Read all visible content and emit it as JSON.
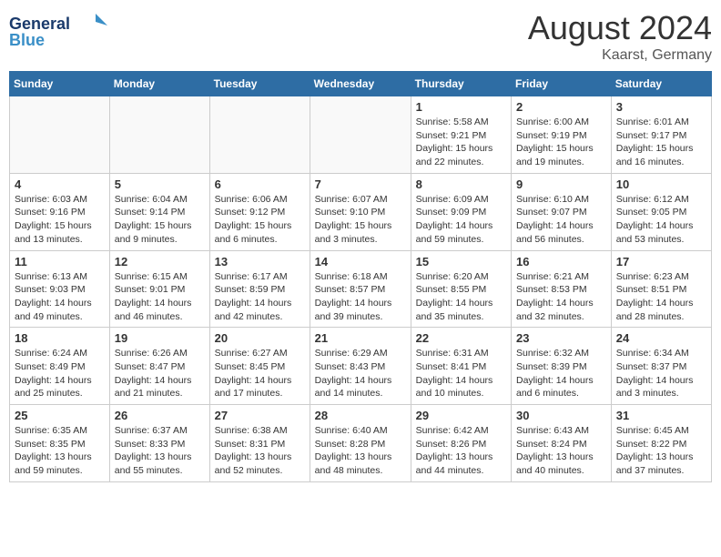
{
  "header": {
    "logo_general": "General",
    "logo_blue": "Blue",
    "month": "August 2024",
    "location": "Kaarst, Germany"
  },
  "weekdays": [
    "Sunday",
    "Monday",
    "Tuesday",
    "Wednesday",
    "Thursday",
    "Friday",
    "Saturday"
  ],
  "weeks": [
    [
      {
        "date": "",
        "info": ""
      },
      {
        "date": "",
        "info": ""
      },
      {
        "date": "",
        "info": ""
      },
      {
        "date": "",
        "info": ""
      },
      {
        "date": "1",
        "info": "Sunrise: 5:58 AM\nSunset: 9:21 PM\nDaylight: 15 hours and 22 minutes."
      },
      {
        "date": "2",
        "info": "Sunrise: 6:00 AM\nSunset: 9:19 PM\nDaylight: 15 hours and 19 minutes."
      },
      {
        "date": "3",
        "info": "Sunrise: 6:01 AM\nSunset: 9:17 PM\nDaylight: 15 hours and 16 minutes."
      }
    ],
    [
      {
        "date": "4",
        "info": "Sunrise: 6:03 AM\nSunset: 9:16 PM\nDaylight: 15 hours and 13 minutes."
      },
      {
        "date": "5",
        "info": "Sunrise: 6:04 AM\nSunset: 9:14 PM\nDaylight: 15 hours and 9 minutes."
      },
      {
        "date": "6",
        "info": "Sunrise: 6:06 AM\nSunset: 9:12 PM\nDaylight: 15 hours and 6 minutes."
      },
      {
        "date": "7",
        "info": "Sunrise: 6:07 AM\nSunset: 9:10 PM\nDaylight: 15 hours and 3 minutes."
      },
      {
        "date": "8",
        "info": "Sunrise: 6:09 AM\nSunset: 9:09 PM\nDaylight: 14 hours and 59 minutes."
      },
      {
        "date": "9",
        "info": "Sunrise: 6:10 AM\nSunset: 9:07 PM\nDaylight: 14 hours and 56 minutes."
      },
      {
        "date": "10",
        "info": "Sunrise: 6:12 AM\nSunset: 9:05 PM\nDaylight: 14 hours and 53 minutes."
      }
    ],
    [
      {
        "date": "11",
        "info": "Sunrise: 6:13 AM\nSunset: 9:03 PM\nDaylight: 14 hours and 49 minutes."
      },
      {
        "date": "12",
        "info": "Sunrise: 6:15 AM\nSunset: 9:01 PM\nDaylight: 14 hours and 46 minutes."
      },
      {
        "date": "13",
        "info": "Sunrise: 6:17 AM\nSunset: 8:59 PM\nDaylight: 14 hours and 42 minutes."
      },
      {
        "date": "14",
        "info": "Sunrise: 6:18 AM\nSunset: 8:57 PM\nDaylight: 14 hours and 39 minutes."
      },
      {
        "date": "15",
        "info": "Sunrise: 6:20 AM\nSunset: 8:55 PM\nDaylight: 14 hours and 35 minutes."
      },
      {
        "date": "16",
        "info": "Sunrise: 6:21 AM\nSunset: 8:53 PM\nDaylight: 14 hours and 32 minutes."
      },
      {
        "date": "17",
        "info": "Sunrise: 6:23 AM\nSunset: 8:51 PM\nDaylight: 14 hours and 28 minutes."
      }
    ],
    [
      {
        "date": "18",
        "info": "Sunrise: 6:24 AM\nSunset: 8:49 PM\nDaylight: 14 hours and 25 minutes."
      },
      {
        "date": "19",
        "info": "Sunrise: 6:26 AM\nSunset: 8:47 PM\nDaylight: 14 hours and 21 minutes."
      },
      {
        "date": "20",
        "info": "Sunrise: 6:27 AM\nSunset: 8:45 PM\nDaylight: 14 hours and 17 minutes."
      },
      {
        "date": "21",
        "info": "Sunrise: 6:29 AM\nSunset: 8:43 PM\nDaylight: 14 hours and 14 minutes."
      },
      {
        "date": "22",
        "info": "Sunrise: 6:31 AM\nSunset: 8:41 PM\nDaylight: 14 hours and 10 minutes."
      },
      {
        "date": "23",
        "info": "Sunrise: 6:32 AM\nSunset: 8:39 PM\nDaylight: 14 hours and 6 minutes."
      },
      {
        "date": "24",
        "info": "Sunrise: 6:34 AM\nSunset: 8:37 PM\nDaylight: 14 hours and 3 minutes."
      }
    ],
    [
      {
        "date": "25",
        "info": "Sunrise: 6:35 AM\nSunset: 8:35 PM\nDaylight: 13 hours and 59 minutes."
      },
      {
        "date": "26",
        "info": "Sunrise: 6:37 AM\nSunset: 8:33 PM\nDaylight: 13 hours and 55 minutes."
      },
      {
        "date": "27",
        "info": "Sunrise: 6:38 AM\nSunset: 8:31 PM\nDaylight: 13 hours and 52 minutes."
      },
      {
        "date": "28",
        "info": "Sunrise: 6:40 AM\nSunset: 8:28 PM\nDaylight: 13 hours and 48 minutes."
      },
      {
        "date": "29",
        "info": "Sunrise: 6:42 AM\nSunset: 8:26 PM\nDaylight: 13 hours and 44 minutes."
      },
      {
        "date": "30",
        "info": "Sunrise: 6:43 AM\nSunset: 8:24 PM\nDaylight: 13 hours and 40 minutes."
      },
      {
        "date": "31",
        "info": "Sunrise: 6:45 AM\nSunset: 8:22 PM\nDaylight: 13 hours and 37 minutes."
      }
    ]
  ]
}
